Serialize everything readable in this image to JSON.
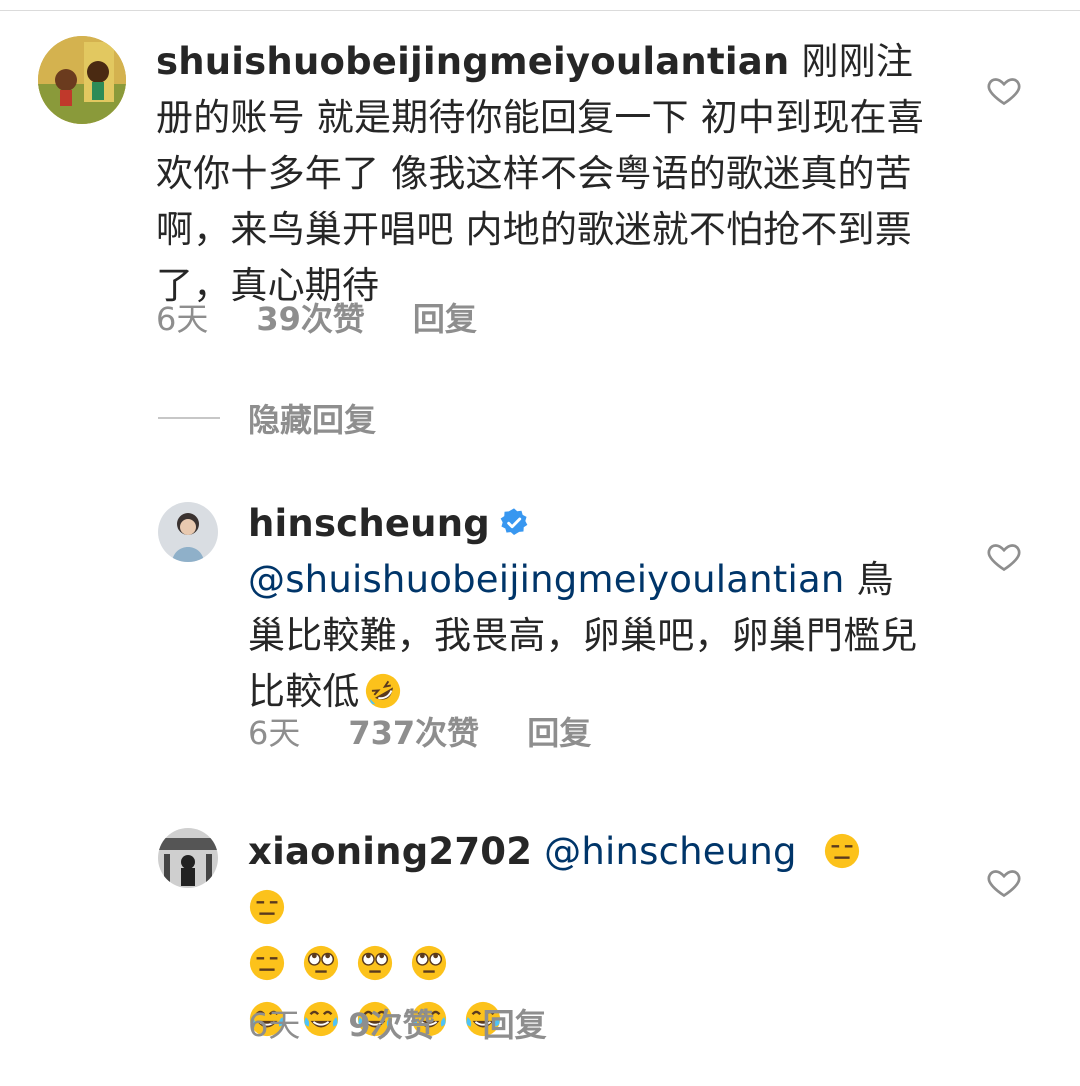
{
  "comments": [
    {
      "username": "shuishuobeijingmeiyoulantian",
      "text": " 刚刚注册的账号 就是期待你能回复一下 初中到现在喜欢你十多年了 像我这样不会粤语的歌迷真的苦啊，来鸟巢开唱吧 内地的歌迷就不怕抢不到票了，真心期待",
      "time": "6天",
      "likes": "39次赞",
      "reply": "回复"
    },
    {
      "username": "hinscheung",
      "verified": true,
      "mention": "@shuishuobeijingmeiyoulantian",
      "text": " 鳥巢比較難，我畏高，卵巢吧，卵巢門檻兒比較低",
      "trailing_emoji": "rolling-on-floor-laughing",
      "time": "6天",
      "likes": "737次赞",
      "reply": "回复"
    },
    {
      "username": "xiaoning2702",
      "mention": " @hinscheung",
      "emoji_rows": [
        [
          "expressionless",
          "expressionless"
        ],
        [
          "expressionless",
          "eye-roll",
          "eye-roll",
          "eye-roll"
        ],
        [
          "tears-of-joy",
          "tears-of-joy",
          "tears-of-joy",
          "tears-of-joy",
          "tears-of-joy"
        ]
      ],
      "time": "6天",
      "likes": "9次赞",
      "reply": "回复"
    }
  ],
  "hide_replies": "隐藏回复",
  "colors": {
    "text": "#262626",
    "meta": "#8e8e8e",
    "mention": "#003569",
    "verified": "#3897f0",
    "divider": "#c7c7c7"
  }
}
